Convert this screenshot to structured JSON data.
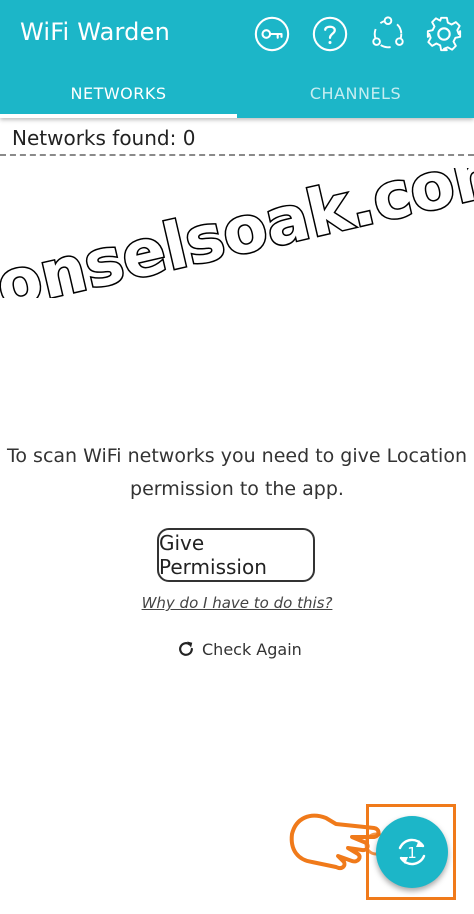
{
  "app": {
    "title": "WiFi Warden"
  },
  "toolbar": {
    "icons": [
      "key-icon",
      "help-icon",
      "share-icon",
      "settings-icon"
    ]
  },
  "tabs": [
    {
      "label": "NETWORKS",
      "active": true
    },
    {
      "label": "CHANNELS",
      "active": false
    }
  ],
  "status": {
    "networks_found": "Networks found: 0"
  },
  "watermark": {
    "text": "ponselsoak.com"
  },
  "permission": {
    "message_line1": "To scan WiFi networks you need to give Location",
    "message_line2": "permission to the app.",
    "give_button": "Give Permission",
    "why_link": "Why do I have to do this?",
    "check_again": "Check Again"
  },
  "fab": {
    "icon": "refresh-one-icon",
    "badge": "1"
  },
  "colors": {
    "primary": "#1cb6c8",
    "highlight": "#f07a1a",
    "text": "#222222"
  }
}
